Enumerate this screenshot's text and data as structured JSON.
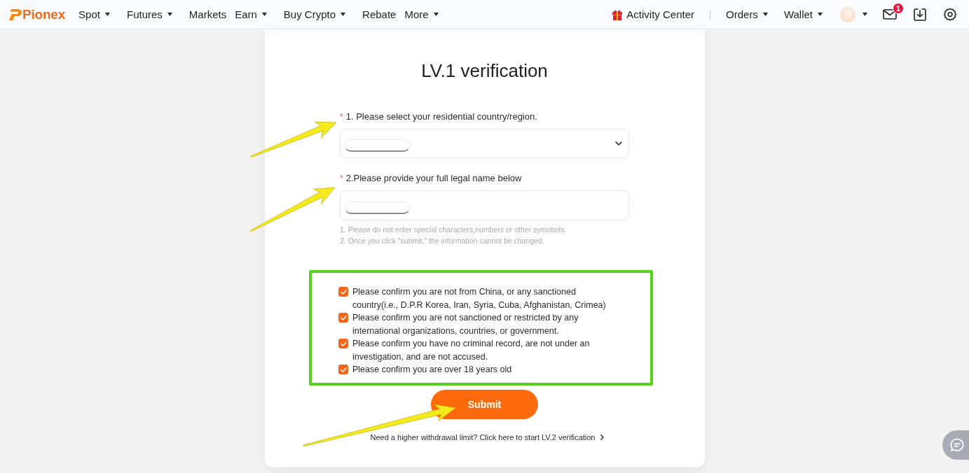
{
  "nav": {
    "logo": "Pionex",
    "menu": [
      {
        "label": "Spot",
        "dropdown": true
      },
      {
        "label": "Futures",
        "dropdown": true
      },
      {
        "label": "Markets",
        "dropdown": false
      },
      {
        "label": "Earn",
        "dropdown": true
      },
      {
        "label": "Buy Crypto",
        "dropdown": true
      },
      {
        "label": "Rebate",
        "dropdown": false
      },
      {
        "label": "More",
        "dropdown": true
      }
    ],
    "activity": "Activity Center",
    "account_menu": [
      {
        "label": "Orders",
        "dropdown": true
      },
      {
        "label": "Wallet",
        "dropdown": true
      }
    ],
    "mail_badge": "1"
  },
  "form": {
    "title": "LV.1 verification",
    "fields": [
      {
        "kind": "select",
        "marker": "*",
        "label": "1. Please select your residential country/region.",
        "value_masked": true
      },
      {
        "kind": "text",
        "marker": "*",
        "label": "2.Please provide your full legal name below",
        "value_masked": true
      }
    ],
    "hints": [
      "1. Please do not enter special characters,numbers or other symobols.",
      "2. Once you click \"submit,\" the information cannot be changed."
    ],
    "confirmations_highlighted": true,
    "confirmations": [
      {
        "text": "Please confirm you are not from China, or any sanctioned country(i.e., D.P.R Korea, Iran, Syria, Cuba, Afghanistan, Crimea)",
        "checked": true
      },
      {
        "text": "Please confirm you are not sanctioned or restricted by any international organizations, countries, or government.",
        "checked": true
      },
      {
        "text": "Please confirm you have no criminal record, are not under an investigation, and are not accused.",
        "checked": true
      },
      {
        "text": "Please confirm you are over 18 years old",
        "checked": true
      }
    ],
    "submit": "Submit",
    "upgrade_link": "Need a higher withdrawal limit? Click here to start LV.2 verification"
  },
  "annotations": [
    {
      "kind": "arrow"
    },
    {
      "kind": "arrow"
    },
    {
      "kind": "arrow"
    }
  ]
}
